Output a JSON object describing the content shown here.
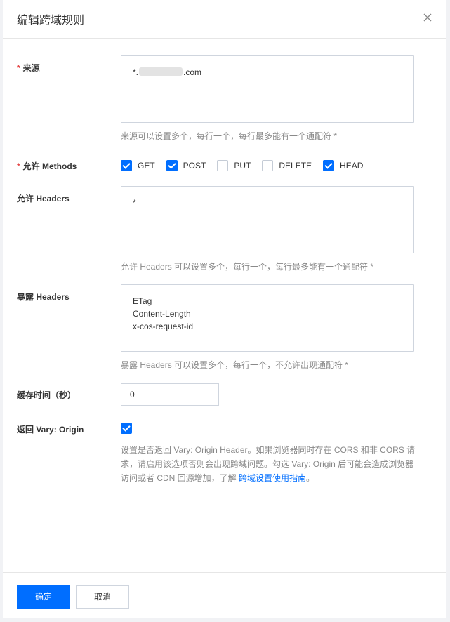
{
  "dialog": {
    "title": "编辑跨域规则"
  },
  "origin": {
    "label": "来源",
    "required_mark": "*",
    "value_prefix": "*.",
    "value_suffix": ".com",
    "hint": "来源可以设置多个，每行一个，每行最多能有一个通配符 *"
  },
  "methods": {
    "label": "允许 Methods",
    "required_mark": "*",
    "items": [
      {
        "label": "GET",
        "checked": true
      },
      {
        "label": "POST",
        "checked": true
      },
      {
        "label": "PUT",
        "checked": false
      },
      {
        "label": "DELETE",
        "checked": false
      },
      {
        "label": "HEAD",
        "checked": true
      }
    ]
  },
  "allow_headers": {
    "label": "允许 Headers",
    "value": "*",
    "hint": "允许 Headers 可以设置多个，每行一个，每行最多能有一个通配符 *"
  },
  "expose_headers": {
    "label": "暴露 Headers",
    "value": "ETag\nContent-Length\nx-cos-request-id",
    "hint": "暴露 Headers 可以设置多个，每行一个，不允许出现通配符 *"
  },
  "max_age": {
    "label": "缓存时间（秒）",
    "value": "0"
  },
  "vary": {
    "label": "返回 Vary: Origin",
    "checked": true,
    "hint_line1": "设置是否返回 Vary: Origin Header。如果浏览器同时存在 CORS 和非 CORS 请",
    "hint_line2": "求，请启用该选项否则会出现跨域问题。勾选 Vary: Origin 后可能会造成浏览器",
    "hint_line3_prefix": "访问或者 CDN 回源增加，了解",
    "hint_link": "跨域设置使用指南",
    "hint_line3_suffix": "。"
  },
  "footer": {
    "confirm_label": "确定",
    "cancel_label": "取消"
  },
  "colors": {
    "primary": "#006eff",
    "required": "#e54545"
  }
}
